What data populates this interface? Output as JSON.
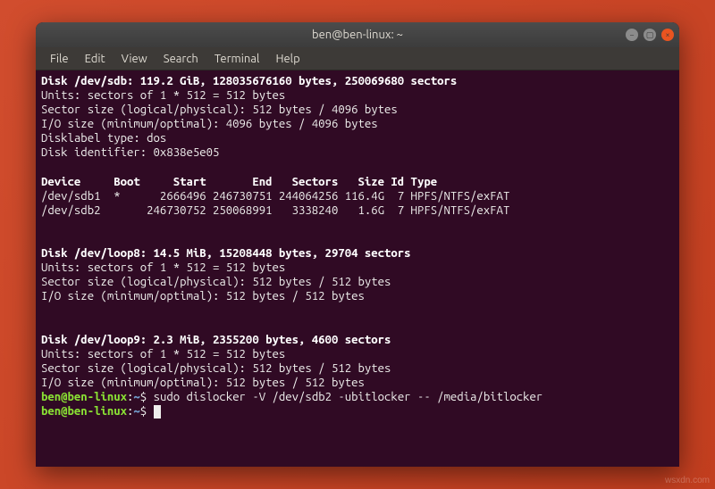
{
  "titlebar": {
    "title": "ben@ben-linux: ~"
  },
  "menubar": {
    "items": [
      "File",
      "Edit",
      "View",
      "Search",
      "Terminal",
      "Help"
    ]
  },
  "window_controls": {
    "min_symbol": "−",
    "max_symbol": "▢",
    "close_symbol": "×"
  },
  "terminal": {
    "sdb_header": "Disk /dev/sdb: 119.2 GiB, 128035676160 bytes, 250069680 sectors",
    "sdb_units": "Units: sectors of 1 * 512 = 512 bytes",
    "sdb_sector": "Sector size (logical/physical): 512 bytes / 4096 bytes",
    "sdb_io": "I/O size (minimum/optimal): 4096 bytes / 4096 bytes",
    "sdb_label": "Disklabel type: dos",
    "sdb_ident": "Disk identifier: 0x838e5e05",
    "part_header": "Device     Boot     Start       End   Sectors   Size Id Type",
    "part_row1": "/dev/sdb1  *      2666496 246730751 244064256 116.4G  7 HPFS/NTFS/exFAT",
    "part_row2": "/dev/sdb2       246730752 250068991   3338240   1.6G  7 HPFS/NTFS/exFAT",
    "loop8_header": "Disk /dev/loop8: 14.5 MiB, 15208448 bytes, 29704 sectors",
    "loop8_units": "Units: sectors of 1 * 512 = 512 bytes",
    "loop8_sector": "Sector size (logical/physical): 512 bytes / 512 bytes",
    "loop8_io": "I/O size (minimum/optimal): 512 bytes / 512 bytes",
    "loop9_header": "Disk /dev/loop9: 2.3 MiB, 2355200 bytes, 4600 sectors",
    "loop9_units": "Units: sectors of 1 * 512 = 512 bytes",
    "loop9_sector": "Sector size (logical/physical): 512 bytes / 512 bytes",
    "loop9_io": "I/O size (minimum/optimal): 512 bytes / 512 bytes",
    "prompt_user": "ben@ben-linux",
    "prompt_colon": ":",
    "prompt_path": "~",
    "prompt_dollar": "$ ",
    "command1": "sudo dislocker -V /dev/sdb2 -ubitlocker -- /media/bitlocker",
    "command2": ""
  },
  "watermark": "wsxdn.com"
}
